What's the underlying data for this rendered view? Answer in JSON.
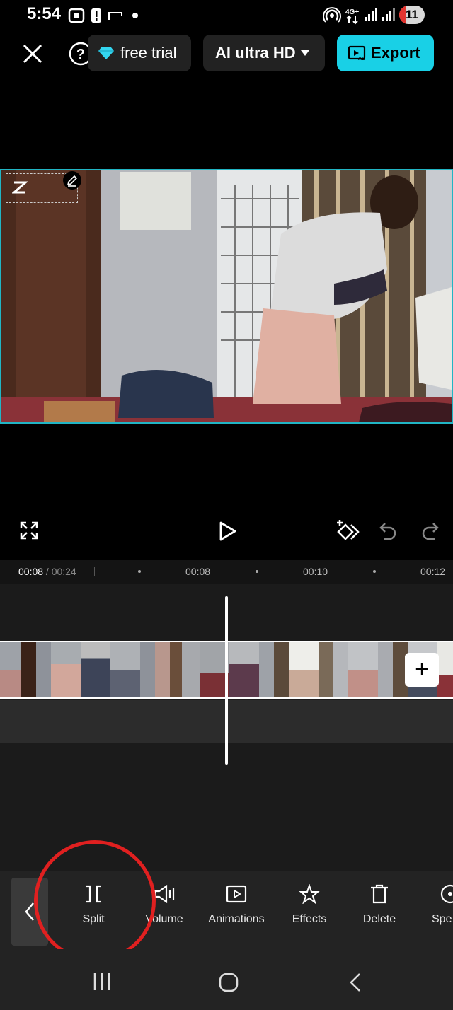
{
  "status_bar": {
    "time": "5:54",
    "battery": "11"
  },
  "header": {
    "free_trial_label": "free trial",
    "quality_label": "AI ultra HD",
    "export_label": "Export"
  },
  "timeline": {
    "current_time": "00:08",
    "separator": " / ",
    "total_time": "00:24",
    "ticks": [
      "00:08",
      "00:10",
      "00:12"
    ]
  },
  "toolbar": {
    "items": [
      {
        "label": "Split",
        "icon": "split-icon"
      },
      {
        "label": "Volume",
        "icon": "volume-icon"
      },
      {
        "label": "Animations",
        "icon": "animations-icon"
      },
      {
        "label": "Effects",
        "icon": "effects-icon"
      },
      {
        "label": "Delete",
        "icon": "delete-icon"
      },
      {
        "label": "Spe",
        "icon": "speed-icon"
      }
    ]
  },
  "colors": {
    "accent": "#19d0e6",
    "annotation_circle": "#e02020",
    "selection_border": "#21b5c4"
  }
}
